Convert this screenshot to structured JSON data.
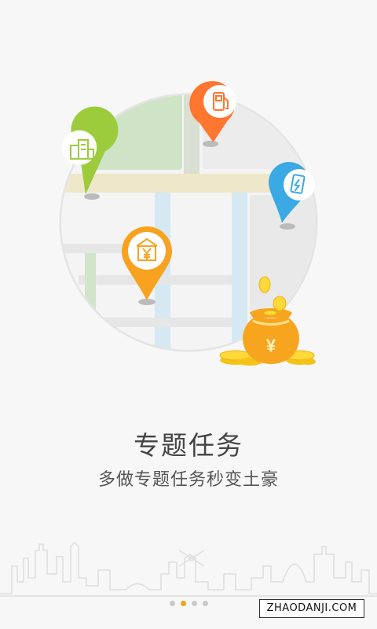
{
  "onboarding": {
    "title": "专题任务",
    "subtitle": "多做专题任务秒变土豪",
    "page_indicator": {
      "total": 4,
      "active_index": 1
    }
  },
  "illustration": {
    "pins": [
      {
        "name": "building-pin",
        "icon": "building-icon",
        "color": "#9ccc3c"
      },
      {
        "name": "gas-station-pin",
        "icon": "gas-pump-icon",
        "color": "#ff7630"
      },
      {
        "name": "charging-station-pin",
        "icon": "ev-charger-icon",
        "color": "#3aa9e4"
      },
      {
        "name": "bank-pin",
        "icon": "bank-yuan-icon",
        "color": "#f9a21f"
      }
    ],
    "money_bag_symbol": "¥"
  },
  "watermark": "ZHAODANJI.COM"
}
